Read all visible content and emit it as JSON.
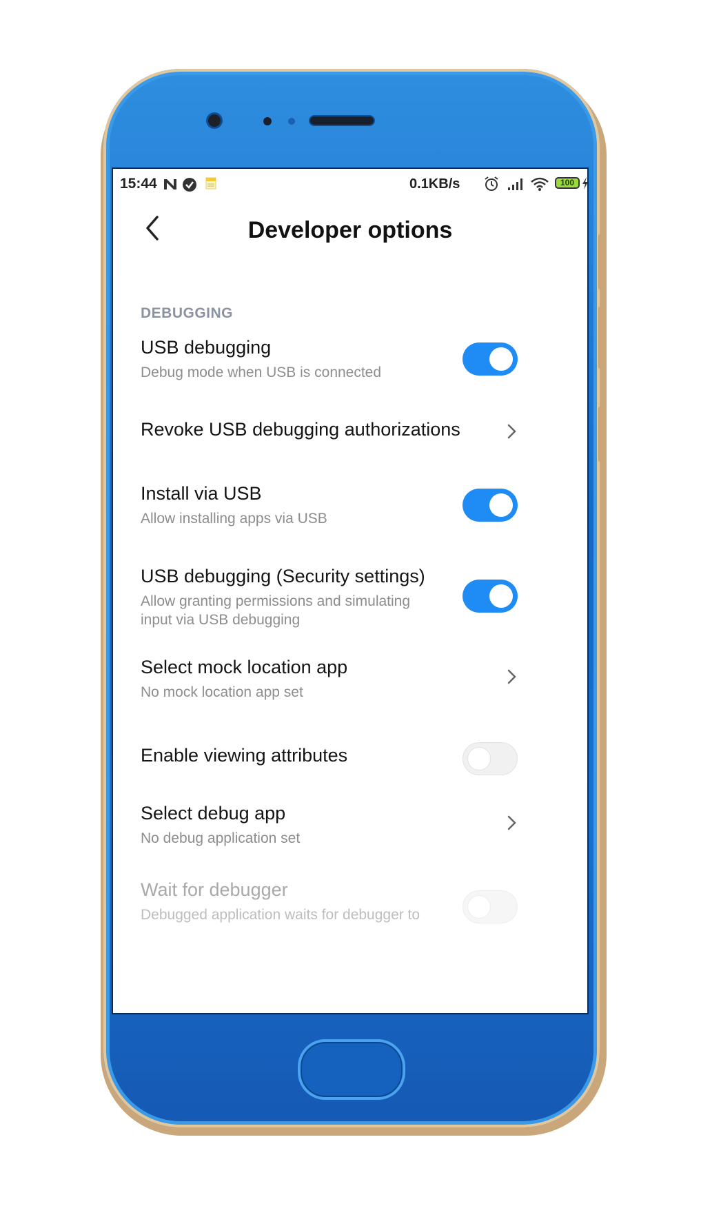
{
  "status_bar": {
    "time": "15:44",
    "net_speed": "0.1KB/s",
    "battery_level": "100",
    "icons": [
      "n-notification-icon",
      "check-circle-icon",
      "note-icon",
      "alarm-icon",
      "signal-icon",
      "wifi-icon",
      "battery-icon",
      "charging-icon"
    ]
  },
  "header": {
    "title": "Developer options",
    "back_icon": "chevron-left-icon"
  },
  "section": {
    "label": "DEBUGGING"
  },
  "items": [
    {
      "title": "USB debugging",
      "subtitle": "Debug mode when USB is connected",
      "control": "toggle",
      "on": true
    },
    {
      "title": "Revoke USB debugging authorizations",
      "subtitle": "",
      "control": "chevron"
    },
    {
      "title": "Install via USB",
      "subtitle": "Allow installing apps via USB",
      "control": "toggle",
      "on": true
    },
    {
      "title": "USB debugging (Security settings)",
      "subtitle": "Allow granting permissions and simulating input via USB debugging",
      "control": "toggle",
      "on": true
    },
    {
      "title": "Select mock location app",
      "subtitle": "No mock location app set",
      "control": "chevron"
    },
    {
      "title": "Enable viewing attributes",
      "subtitle": "",
      "control": "toggle",
      "on": false
    },
    {
      "title": "Select debug app",
      "subtitle": "No debug application set",
      "control": "chevron"
    },
    {
      "title": "Wait for debugger",
      "subtitle": "Debugged application waits for debugger to",
      "control": "toggle",
      "on": false,
      "disabled": true
    }
  ],
  "colors": {
    "accent": "#1e8cf4",
    "phone_body": "#1668c4",
    "phone_trim": "#c9a77b"
  }
}
